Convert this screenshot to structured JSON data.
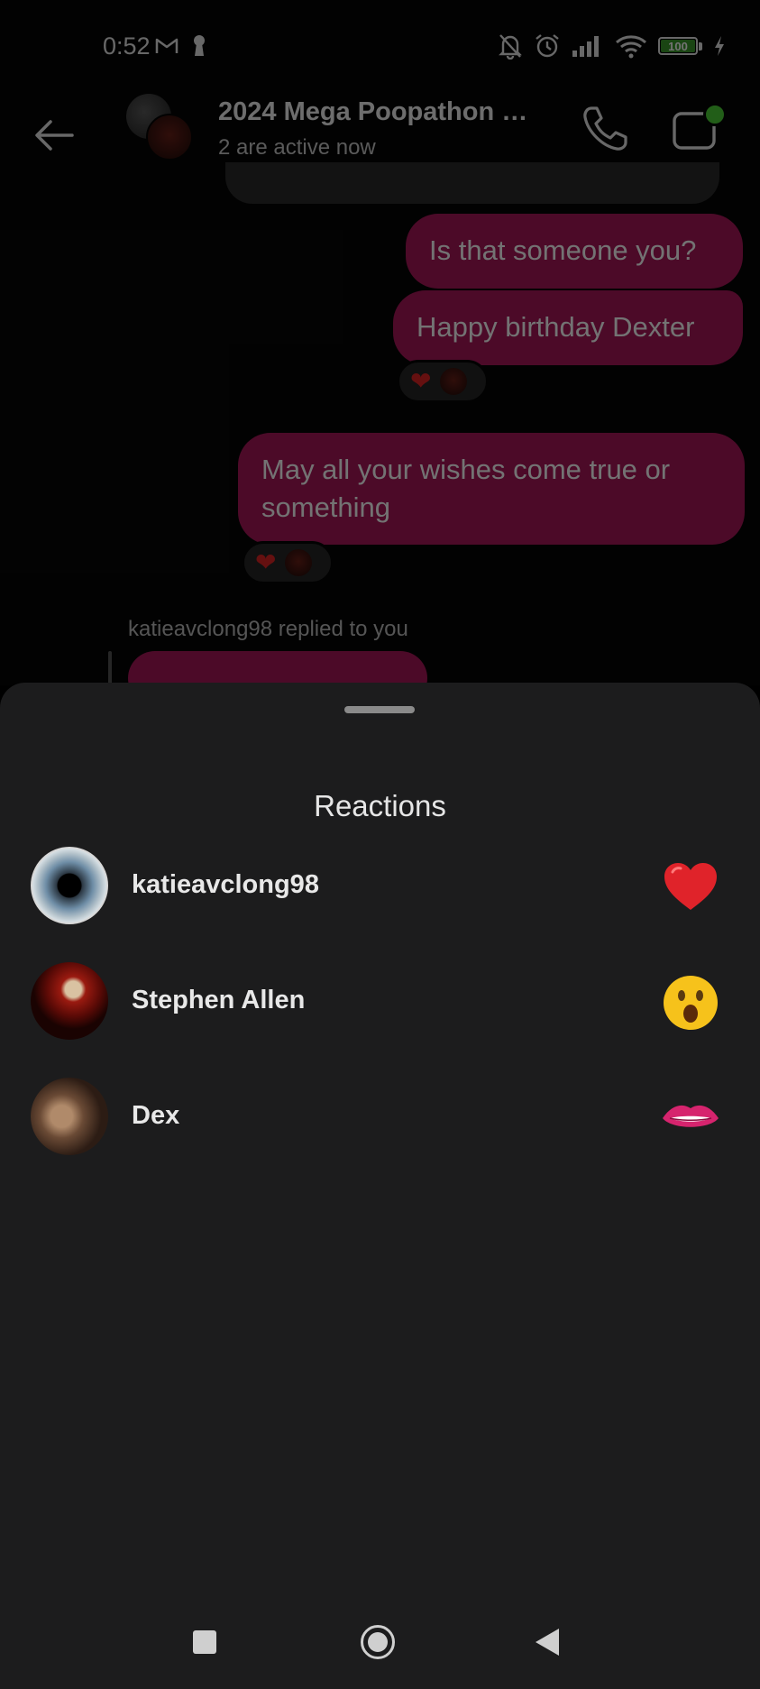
{
  "status_bar": {
    "time": "0:52",
    "left_icons": [
      "gmail-icon",
      "keyhole-icon"
    ],
    "right_icons": [
      "mute-bell-icon",
      "alarm-icon",
      "signal-icon",
      "wifi-icon",
      "battery-icon",
      "charging-icon"
    ],
    "battery_level": "100"
  },
  "chat_header": {
    "title": "2024 Mega Poopathon …",
    "subtitle": "2 are active now"
  },
  "messages": [
    {
      "text": "Is that someone you?",
      "reactions": []
    },
    {
      "text": "Happy birthday Dexter",
      "reactions": [
        "heart",
        "avatar"
      ]
    },
    {
      "text": "May all your wishes come true or something",
      "reactions": [
        "heart",
        "avatar"
      ]
    }
  ],
  "reply": {
    "label": "katieavclong98 replied to you"
  },
  "sheet": {
    "title": "Reactions",
    "items": [
      {
        "name": "katieavclong98",
        "emoji": "red-heart"
      },
      {
        "name": "Stephen Allen",
        "emoji": "astonished-face"
      },
      {
        "name": "Dex",
        "emoji": "biting-lip"
      }
    ]
  },
  "colors": {
    "bubble": "#a8175a",
    "sheet_bg": "#1c1c1d",
    "heart": "#e02424"
  }
}
